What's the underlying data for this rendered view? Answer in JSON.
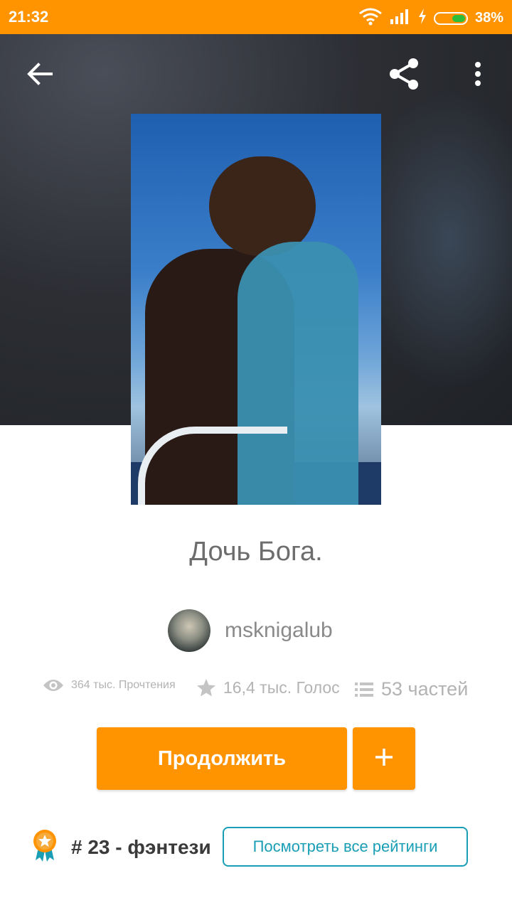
{
  "status_bar": {
    "time": "21:32",
    "battery_text": "38%",
    "battery_level": 0.38
  },
  "toolbar": {
    "back_icon": "back-arrow-icon",
    "share_icon": "share-icon",
    "more_icon": "more-vert-icon"
  },
  "story": {
    "title": "Дочь Бога.",
    "author": "msknigalub"
  },
  "stats": {
    "reads": "364 тыс. Прочтения",
    "votes": "16,4 тыс. Голос",
    "parts": "53 частей"
  },
  "actions": {
    "continue_label": "Продолжить",
    "add_label": "+"
  },
  "ranking": {
    "text": "# 23 - фэнтези",
    "button_label": "Посмотреть все рейтинги"
  },
  "colors": {
    "accent": "#ff9400",
    "teal": "#1a9eb5",
    "battery_green": "#2ebd3a"
  }
}
